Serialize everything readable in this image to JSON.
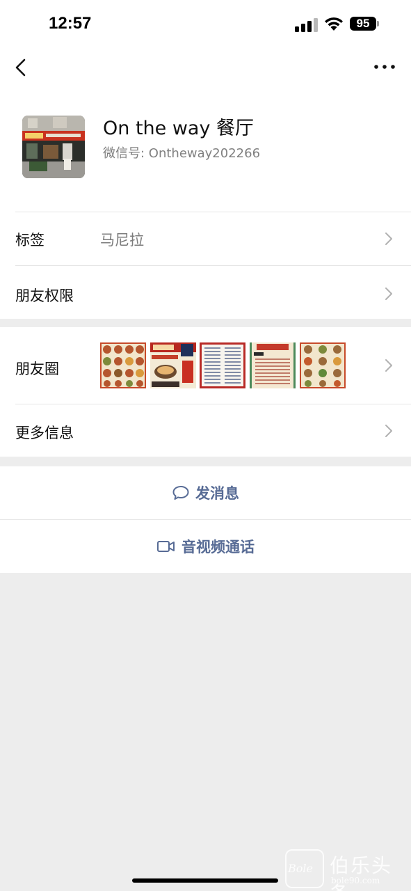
{
  "status_bar": {
    "time": "12:57",
    "battery": "95"
  },
  "nav": {
    "back_icon": "chevron-left-icon",
    "more_icon": "ellipsis-icon"
  },
  "profile": {
    "name": "On the way 餐厅",
    "wechat_id": "微信号: Ontheway202266"
  },
  "rows": {
    "tag": {
      "label": "标签",
      "value": "马尼拉"
    },
    "permissions": {
      "label": "朋友权限"
    },
    "moments": {
      "label": "朋友圈",
      "thumbnail_count": 5
    },
    "more_info": {
      "label": "更多信息"
    }
  },
  "actions": {
    "message": {
      "label": "发消息",
      "icon": "chat-bubble-icon"
    },
    "video_call": {
      "label": "音视频通话",
      "icon": "video-camera-icon"
    }
  },
  "watermark": {
    "text": "伯乐头条",
    "sub": "bole90.com",
    "logo": "Bole"
  },
  "colors": {
    "link_blue": "#576b95",
    "background": "#ededed",
    "secondary_text": "#808080"
  }
}
